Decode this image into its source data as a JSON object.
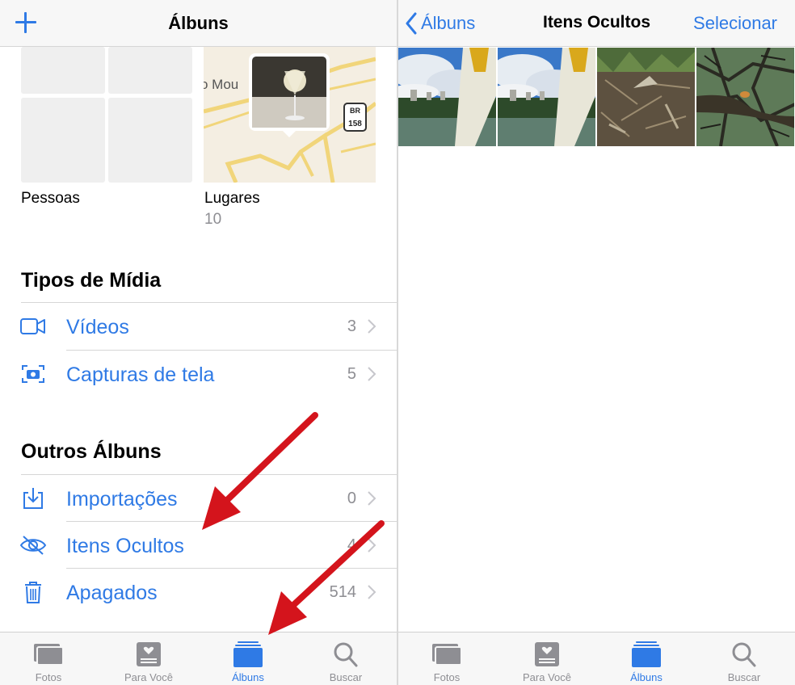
{
  "left": {
    "nav": {
      "title": "Álbuns"
    },
    "people": {
      "label": "Pessoas"
    },
    "places": {
      "label": "Lugares",
      "count": "10",
      "map_text": "o Mou",
      "road_badge_top": "BR",
      "road_badge_num": "158"
    },
    "media_types": {
      "title": "Tipos de Mídia",
      "items": [
        {
          "label": "Vídeos",
          "count": "3",
          "icon": "video-icon"
        },
        {
          "label": "Capturas de tela",
          "count": "5",
          "icon": "screenshot-icon"
        }
      ]
    },
    "other_albums": {
      "title": "Outros Álbuns",
      "items": [
        {
          "label": "Importações",
          "count": "0",
          "icon": "import-icon"
        },
        {
          "label": "Itens Ocultos",
          "count": "4",
          "icon": "eye-slash-icon"
        },
        {
          "label": "Apagados",
          "count": "514",
          "icon": "trash-icon"
        }
      ]
    }
  },
  "right": {
    "nav": {
      "back_label": "Álbuns",
      "title": "Itens Ocultos",
      "action_label": "Selecionar"
    },
    "photo_count": 4
  },
  "tabs": [
    {
      "label": "Fotos",
      "icon": "photos-icon"
    },
    {
      "label": "Para Você",
      "icon": "for-you-icon"
    },
    {
      "label": "Álbuns",
      "icon": "albums-icon",
      "active": true
    },
    {
      "label": "Buscar",
      "icon": "search-icon"
    }
  ],
  "colors": {
    "accent": "#2f7ae5",
    "secondary_text": "#8e8e93",
    "arrow": "#d4141c",
    "tab_inactive": "#8e8e93"
  }
}
